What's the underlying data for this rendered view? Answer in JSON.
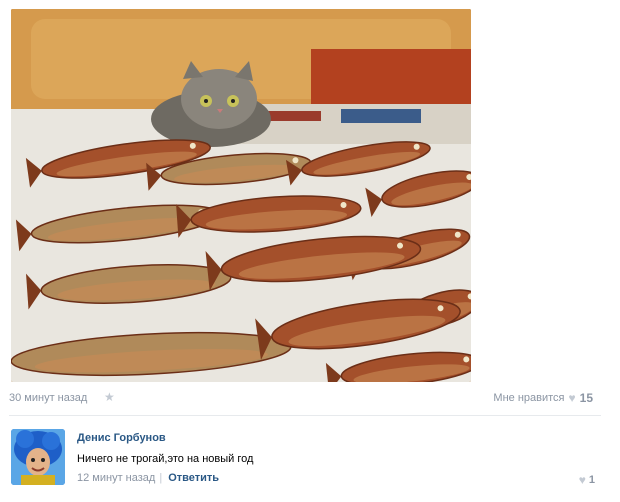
{
  "post": {
    "time": "30 минут назад",
    "like_label": "Мне нравится",
    "like_count": "15",
    "photo_icon": "fish-and-cat-photo"
  },
  "comment": {
    "author": "Денис Горбунов",
    "text": "Ничего не трогай,это на новый год",
    "time": "12 минут назад",
    "reply_label": "Ответить",
    "like_count": "1"
  },
  "colors": {
    "link": "#2a5885",
    "meta": "#8b95a3",
    "heart": "#c3cad3"
  }
}
